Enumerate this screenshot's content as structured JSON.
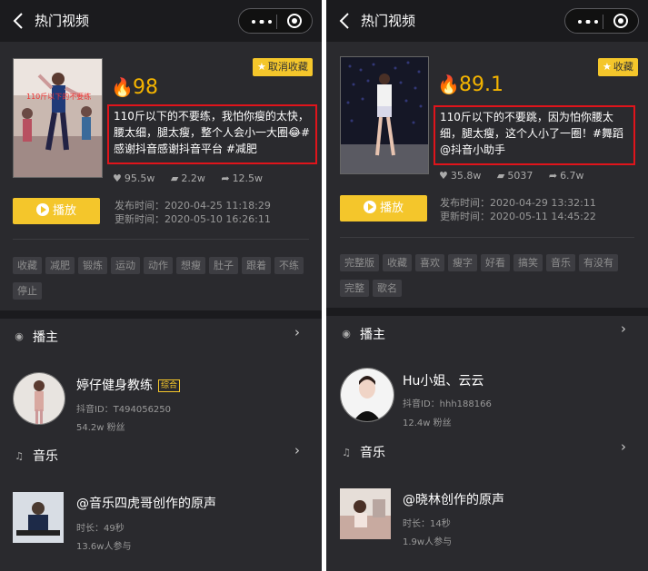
{
  "panels": [
    {
      "topbar": {
        "title": "热门视频"
      },
      "video": {
        "score": "98",
        "fav_label": "取消收藏",
        "description": "110斤以下的不要练，我怕你瘦的太快，腰太细，腿太瘦，整个人会小一大圈😂#感谢抖音感谢抖音平台 #减肥",
        "likes": "95.5w",
        "comments": "2.2w",
        "shares": "12.5w",
        "play_label": "播放",
        "publish_time": "发布时间：2020-04-25 11:18:29",
        "update_time": "更新时间：2020-05-10 16:26:11",
        "thumb_text": "110斤以下的不要练"
      },
      "tags": [
        "收藏",
        "减肥",
        "锻炼",
        "运动",
        "动作",
        "想瘦",
        "肚子",
        "跟着",
        "不练",
        "停止"
      ],
      "creator_section": {
        "title": "播主"
      },
      "creator": {
        "name": "婷仔健身教练",
        "badge": "综合",
        "id": "抖音ID：T494056250",
        "fans": "54.2w 粉丝"
      },
      "music_section": {
        "title": "音乐"
      },
      "music": {
        "title": "@音乐四虎哥创作的原声",
        "duration": "时长：49秒",
        "users": "13.6w人参与"
      }
    },
    {
      "topbar": {
        "title": "热门视频"
      },
      "video": {
        "score": "89.1",
        "fav_label": "收藏",
        "description": "110斤以下的不要跳，因为怕你腰太细，腿太瘦，这个人小了一圈！#舞蹈 @抖音小助手",
        "likes": "35.8w",
        "comments": "5037",
        "shares": "6.7w",
        "play_label": "播放",
        "publish_time": "发布时间：2020-04-29 13:32:11",
        "update_time": "更新时间：2020-05-11 14:45:22"
      },
      "tags": [
        "完整版",
        "收藏",
        "喜欢",
        "瘦字",
        "好看",
        "搞笑",
        "音乐",
        "有没有",
        "完整",
        "歌名"
      ],
      "creator_section": {
        "title": "播主"
      },
      "creator": {
        "name": "Hu小姐、云云",
        "id": "抖音ID：hhh188166",
        "fans": "12.4w 粉丝"
      },
      "music_section": {
        "title": "音乐"
      },
      "music": {
        "title": "@晓林创作的原声",
        "duration": "时长：14秒",
        "users": "1.9w人参与"
      }
    }
  ],
  "icons": {
    "fire": "fire-icon",
    "heart": "heart-icon",
    "comment": "comment-icon",
    "share": "share-icon",
    "star": "star-icon",
    "back": "back-icon",
    "more": "more-icon",
    "close": "target-close-icon"
  },
  "colors": {
    "accent": "#f4c62b",
    "highlight_border": "#e0141b",
    "background": "#2a2a2e",
    "score": "#f4b400"
  }
}
